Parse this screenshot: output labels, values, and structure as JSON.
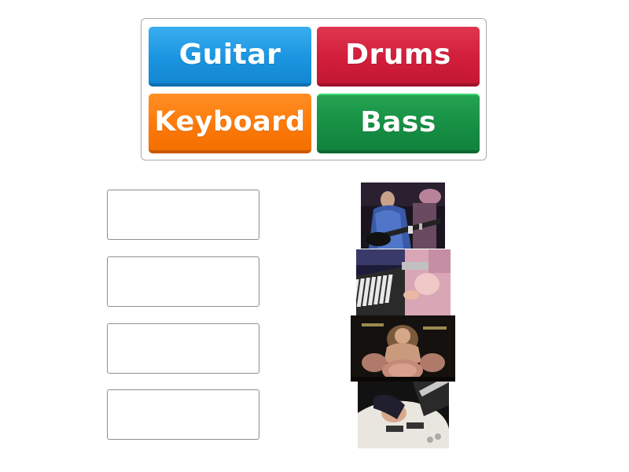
{
  "word_bank": {
    "tiles": [
      {
        "label": "Guitar",
        "color": "#1b95e0"
      },
      {
        "label": "Drums",
        "color": "#d11e3b"
      },
      {
        "label": "Keyboard",
        "color": "#fd7a0a"
      },
      {
        "label": "Bass",
        "color": "#178f44"
      }
    ]
  },
  "match_rows": [
    {
      "drop_value": "",
      "image": "guitarist-playing-bass-photo"
    },
    {
      "drop_value": "",
      "image": "keyboard-player-photo"
    },
    {
      "drop_value": "",
      "image": "drummer-at-kit-photo"
    },
    {
      "drop_value": "",
      "image": "electric-guitar-closeup-photo"
    }
  ]
}
